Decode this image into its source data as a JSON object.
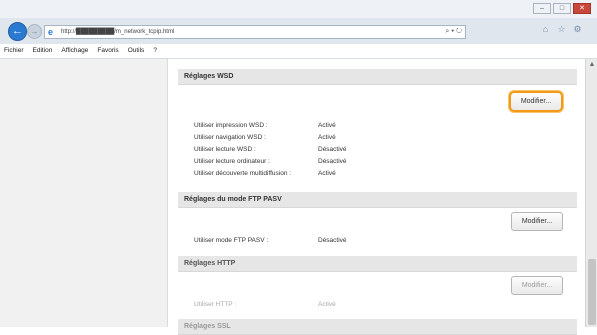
{
  "browser": {
    "url": "http://█████████/m_network_tcpip.html",
    "address_tools": "⌕ ▾ ↻",
    "window_buttons": [
      "–",
      "□",
      "✕"
    ],
    "nav_icons": [
      "home-icon",
      "star-icon",
      "gear-icon"
    ]
  },
  "menu": [
    "Fichier",
    "Edition",
    "Affichage",
    "Favoris",
    "Outils",
    "?"
  ],
  "sections": [
    {
      "title": "Réglages WSD",
      "button": "Modifier...",
      "rows": [
        {
          "label": "Utiliser impression WSD :",
          "value": "Activé"
        },
        {
          "label": "Utiliser navigation WSD :",
          "value": "Activé"
        },
        {
          "label": "Utiliser lecture WSD :",
          "value": "Désactivé"
        },
        {
          "label": "Utiliser lecture ordinateur :",
          "value": "Désactivé"
        },
        {
          "label": "Utiliser découverte multidiffusion :",
          "value": "Activé"
        }
      ]
    },
    {
      "title": "Réglages du mode FTP PASV",
      "button": "Modifier...",
      "rows": [
        {
          "label": "Utiliser mode FTP PASV :",
          "value": "Désactivé"
        }
      ]
    },
    {
      "title": "Réglages HTTP",
      "button": "Modifier...",
      "rows": [
        {
          "label": "Utiliser HTTP :",
          "value": "Activé"
        }
      ]
    },
    {
      "title": "Réglages SSL"
    }
  ],
  "colors": {
    "highlight": "#f19a17",
    "back_button": "#2b7ad1",
    "close_button": "#c9473a"
  }
}
